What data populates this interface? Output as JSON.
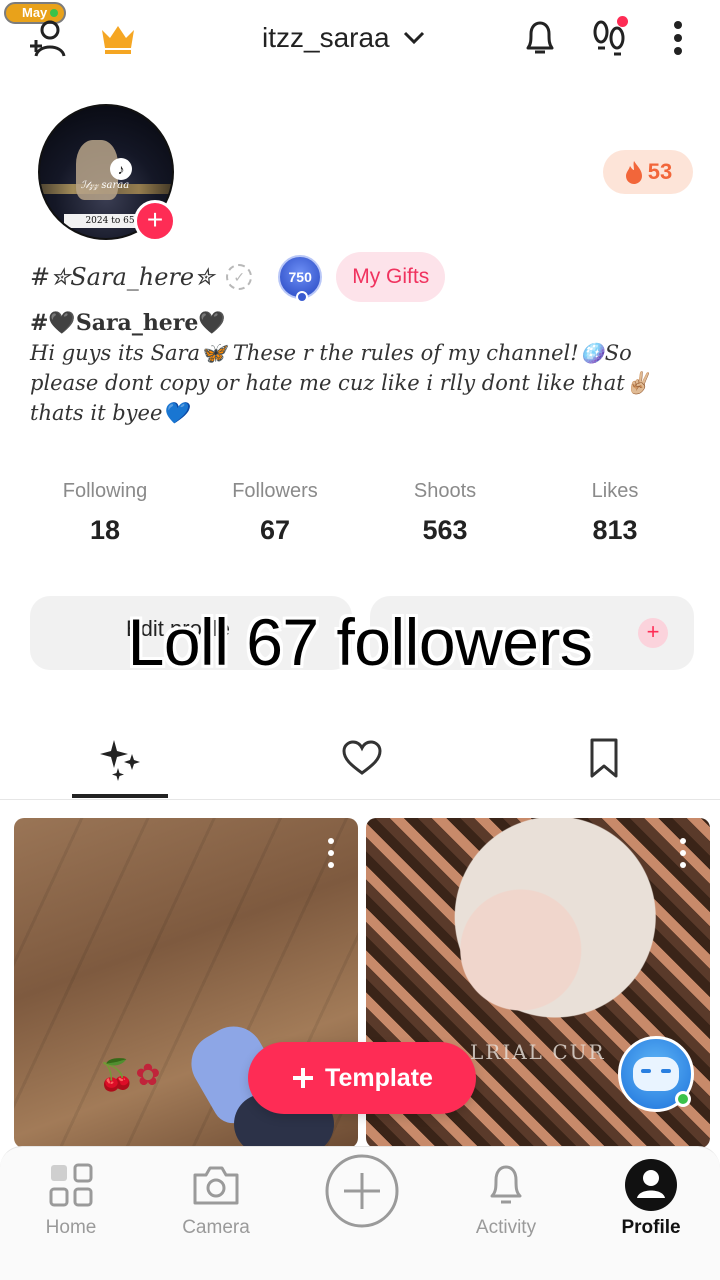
{
  "status": {
    "live_label": "May"
  },
  "header": {
    "username": "itzz_saraa"
  },
  "profile": {
    "avatar_name_text": "ℐ𝓉𝓏𝓏 saraa",
    "avatar_caption": "2024 to 65",
    "streak_count": "53",
    "nickname": "#✮Sara_here✮",
    "level": "750",
    "gifts_label": "My Gifts",
    "bio_title": "#🖤Sara_here🖤",
    "bio_text": "Hi guys its Sara🦋 These r the rules of my channel!🪩So please dont copy or hate me cuz like i rlly dont like that✌🏼 thats it byee💙"
  },
  "stats": [
    {
      "label": "Following",
      "value": "18"
    },
    {
      "label": "Followers",
      "value": "67"
    },
    {
      "label": "Shoots",
      "value": "563"
    },
    {
      "label": "Likes",
      "value": "813"
    }
  ],
  "actions": {
    "edit_label": "Edit profile"
  },
  "overlay": {
    "caption": "Loll 67 followers"
  },
  "tabs": [
    "sparkles-icon",
    "heart-icon",
    "bookmark-icon"
  ],
  "grid": {
    "tile2_text": "LRIAL CUR"
  },
  "template_button": {
    "label": "Template"
  },
  "bottom_nav": [
    {
      "label": "Home",
      "icon": "grid-icon"
    },
    {
      "label": "Camera",
      "icon": "camera-icon"
    },
    {
      "label": "",
      "icon": "plus-circle-icon"
    },
    {
      "label": "Activity",
      "icon": "bell-icon"
    },
    {
      "label": "Profile",
      "icon": "profile-icon"
    }
  ],
  "colors": {
    "accent": "#fe2c55",
    "streak": "#f2663a",
    "level": "#3a5bd0"
  }
}
